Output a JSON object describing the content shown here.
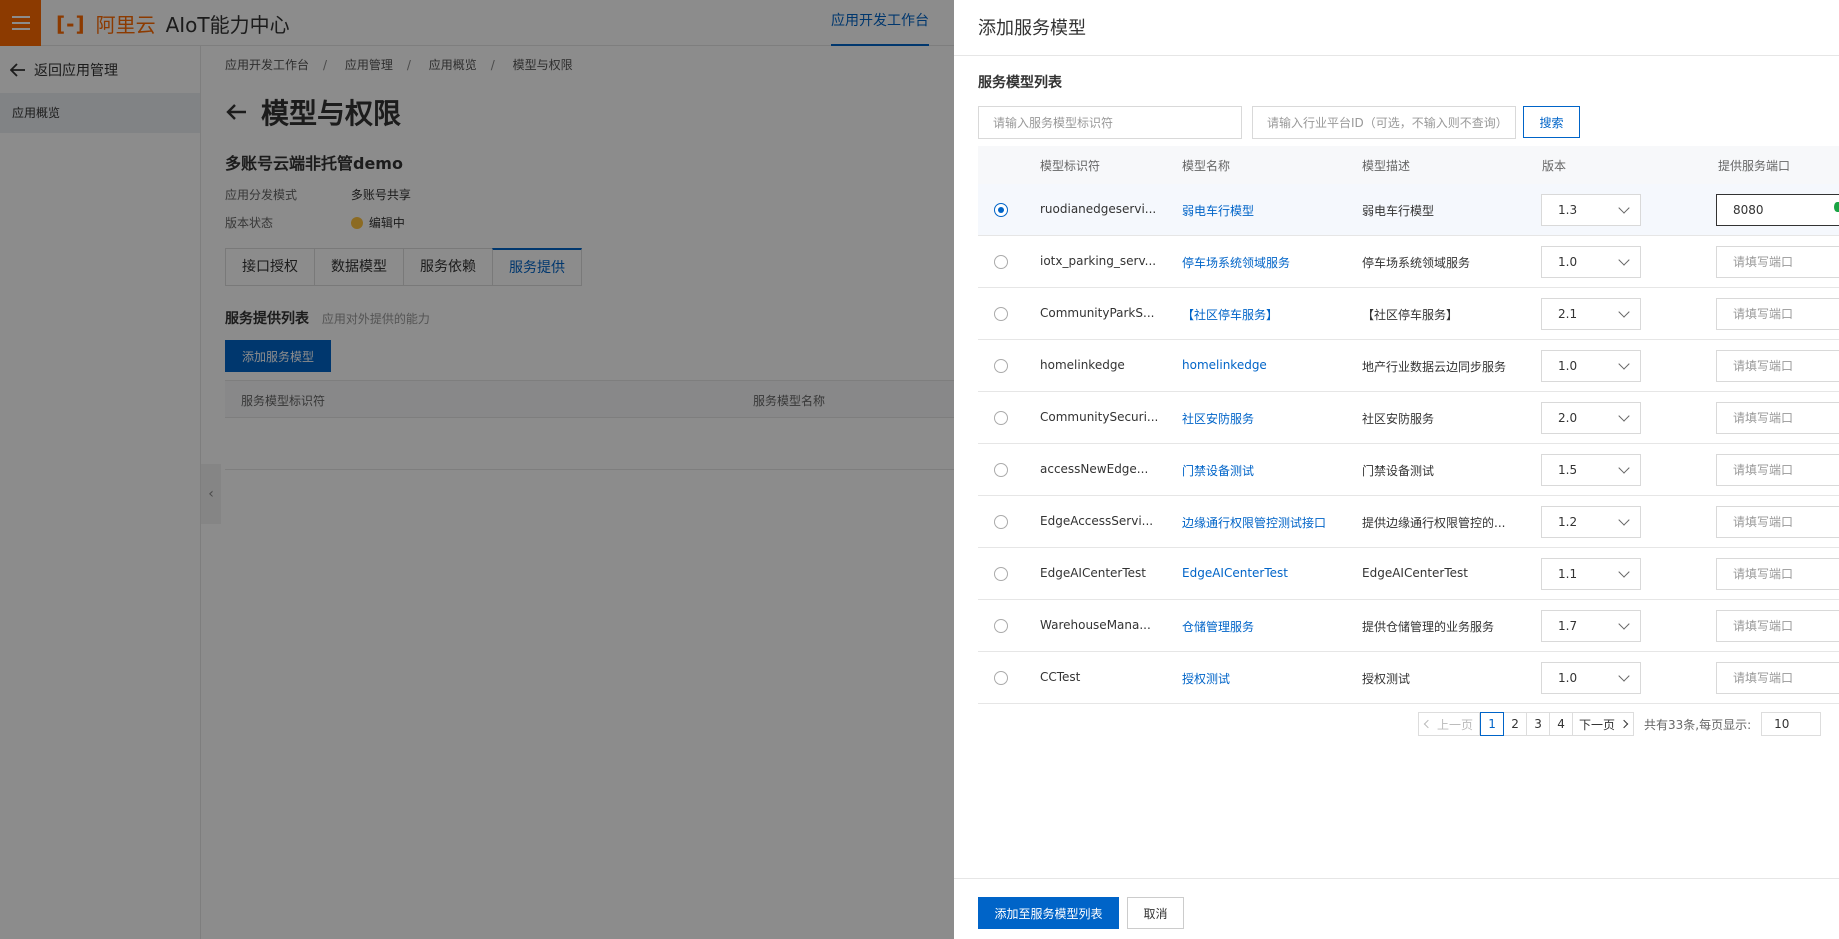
{
  "topbar": {
    "brand_mark": "[-]",
    "brand": "阿里云",
    "title": "AIoT能力中心",
    "nav_active": "应用开发工作台"
  },
  "sidebar": {
    "back": "返回应用管理",
    "items": [
      {
        "label": "应用概览"
      }
    ]
  },
  "content": {
    "breadcrumb": [
      "应用开发工作台",
      "应用管理",
      "应用概览",
      "模型与权限"
    ],
    "page_title": "模型与权限",
    "app_name": "多账号云端非托管demo",
    "fields": [
      {
        "key": "应用分发模式",
        "value": "多账号共享"
      },
      {
        "key": "版本状态",
        "value": "编辑中"
      }
    ],
    "tabs": [
      "接口授权",
      "数据模型",
      "服务依赖",
      "服务提供"
    ],
    "active_tab": "服务提供",
    "section_title": "服务提供列表",
    "section_sub": "应用对外提供的能力",
    "add_button": "添加服务模型",
    "table_headers": [
      "服务模型标识符",
      "服务模型名称"
    ]
  },
  "drawer": {
    "title": "添加服务模型",
    "list_title": "服务模型列表",
    "search": {
      "id_placeholder": "请输入服务模型标识符",
      "platform_placeholder": "请输入行业平台ID（可选，不输入则不查询）",
      "button": "搜索"
    },
    "headers": {
      "id": "模型标识符",
      "name": "模型名称",
      "desc": "模型描述",
      "version": "版本",
      "port": "提供服务端口"
    },
    "port_placeholder": "请填写端口",
    "rows": [
      {
        "id": "ruodianedgeservi...",
        "name": "弱电车行模型",
        "desc": "弱电车行模型",
        "version": "1.3",
        "port": "8080",
        "selected": true
      },
      {
        "id": "iotx_parking_serv...",
        "name": "停车场系统领域服务",
        "desc": "停车场系统领域服务",
        "version": "1.0",
        "port": "",
        "selected": false
      },
      {
        "id": "CommunityParkS...",
        "name": "【社区停车服务】",
        "desc": "【社区停车服务】",
        "version": "2.1",
        "port": "",
        "selected": false
      },
      {
        "id": "homelinkedge",
        "name": "homelinkedge",
        "desc": "地产行业数据云边同步服务",
        "version": "1.0",
        "port": "",
        "selected": false
      },
      {
        "id": "CommunitySecuri...",
        "name": "社区安防服务",
        "desc": "社区安防服务",
        "version": "2.0",
        "port": "",
        "selected": false
      },
      {
        "id": "accessNewEdge...",
        "name": "门禁设备测试",
        "desc": "门禁设备测试",
        "version": "1.5",
        "port": "",
        "selected": false
      },
      {
        "id": "EdgeAccessServi...",
        "name": "边缘通行权限管控测试接口",
        "desc": "提供边缘通行权限管控的...",
        "version": "1.2",
        "port": "",
        "selected": false
      },
      {
        "id": "EdgeAICenterTest",
        "name": "EdgeAICenterTest",
        "desc": "EdgeAICenterTest",
        "version": "1.1",
        "port": "",
        "selected": false
      },
      {
        "id": "WarehouseMana...",
        "name": "仓储管理服务",
        "desc": "提供仓储管理的业务服务",
        "version": "1.7",
        "port": "",
        "selected": false
      },
      {
        "id": "CCTest",
        "name": "授权测试",
        "desc": "授权测试",
        "version": "1.0",
        "port": "",
        "selected": false
      }
    ],
    "pagination": {
      "prev": "上一页",
      "pages": [
        "1",
        "2",
        "3",
        "4"
      ],
      "current": "1",
      "next": "下一页",
      "total": "共有33条,每页显示:",
      "page_size": "10"
    },
    "footer": {
      "submit": "添加至服务模型列表",
      "cancel": "取消"
    }
  },
  "colors": {
    "accent": "#0064c8",
    "brand": "#ff6a00",
    "status_editing": "#ffc440"
  }
}
